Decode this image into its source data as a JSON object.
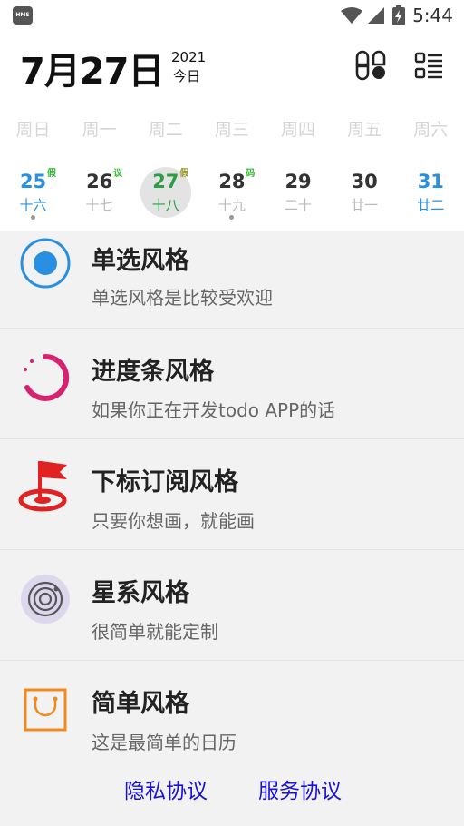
{
  "status_bar": {
    "left_badge": "HMS",
    "time": "5:44",
    "icons": [
      "wifi-icon",
      "signal-icon",
      "battery-charging-icon"
    ]
  },
  "header": {
    "date": "7月27日",
    "year": "2021",
    "today_label": "今日",
    "buttons": [
      "grid-view-icon",
      "list-view-icon"
    ]
  },
  "weekdays": [
    "周日",
    "周一",
    "周二",
    "周三",
    "周四",
    "周五",
    "周六"
  ],
  "days": [
    {
      "num": "25",
      "lunar": "十六",
      "mark": "假",
      "mark_color": "#33bb33",
      "dot": true,
      "style": "blue"
    },
    {
      "num": "26",
      "lunar": "十七",
      "mark": "议",
      "mark_color": "#33bb33",
      "dot": false,
      "style": "normal"
    },
    {
      "num": "27",
      "lunar": "十八",
      "mark": "假",
      "mark_color": "#9a9a2e",
      "dot": false,
      "style": "green",
      "selected": true
    },
    {
      "num": "28",
      "lunar": "十九",
      "mark": "码",
      "mark_color": "#33bb33",
      "dot": true,
      "style": "normal"
    },
    {
      "num": "29",
      "lunar": "二十",
      "mark": "",
      "mark_color": "",
      "dot": false,
      "style": "normal"
    },
    {
      "num": "30",
      "lunar": "廿一",
      "mark": "",
      "mark_color": "",
      "dot": false,
      "style": "normal"
    },
    {
      "num": "31",
      "lunar": "廿二",
      "mark": "",
      "mark_color": "",
      "dot": false,
      "style": "blue"
    }
  ],
  "styles": [
    {
      "title": "单选风格",
      "subtitle": "单选风格是比较受欢迎",
      "icon": "radio-button-icon"
    },
    {
      "title": "进度条风格",
      "subtitle": "如果你正在开发todo APP的话",
      "icon": "progress-ring-icon"
    },
    {
      "title": "下标订阅风格",
      "subtitle": "只要你想画，就能画",
      "icon": "flag-icon"
    },
    {
      "title": "星系风格",
      "subtitle": "很简单就能定制",
      "icon": "galaxy-icon"
    },
    {
      "title": "简单风格",
      "subtitle": "这是最简单的日历",
      "icon": "shopping-bag-icon"
    }
  ],
  "footer": {
    "privacy": "隐私协议",
    "service": "服务协议"
  },
  "colors": {
    "accent_blue": "#2a8fe0",
    "accent_green": "#2e9e46",
    "link": "#1a12d8",
    "progress_pink": "#d6226f",
    "flag_red": "#e02222",
    "bag_orange": "#f08a1d"
  }
}
